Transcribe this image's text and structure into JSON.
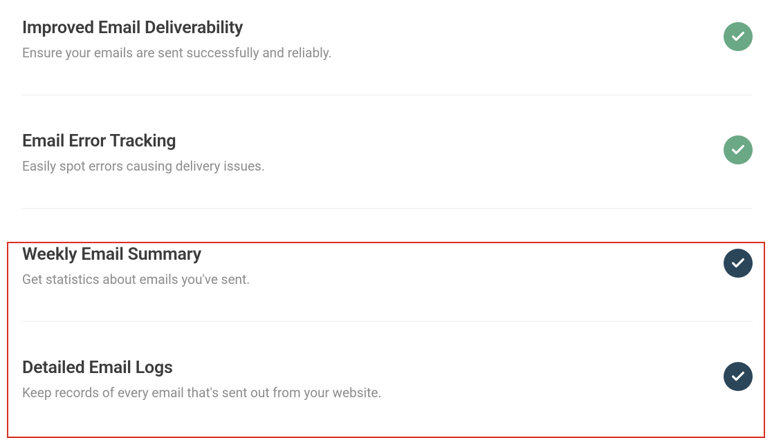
{
  "features": [
    {
      "title": "Improved Email Deliverability",
      "desc": "Ensure your emails are sent successfully and reliably.",
      "check_style": "green"
    },
    {
      "title": "Email Error Tracking",
      "desc": "Easily spot errors causing delivery issues.",
      "check_style": "green"
    },
    {
      "title": "Weekly Email Summary",
      "desc": "Get statistics about emails you've sent.",
      "check_style": "dark"
    },
    {
      "title": "Detailed Email Logs",
      "desc": "Keep records of every email that's sent out from your website.",
      "check_style": "dark"
    }
  ]
}
